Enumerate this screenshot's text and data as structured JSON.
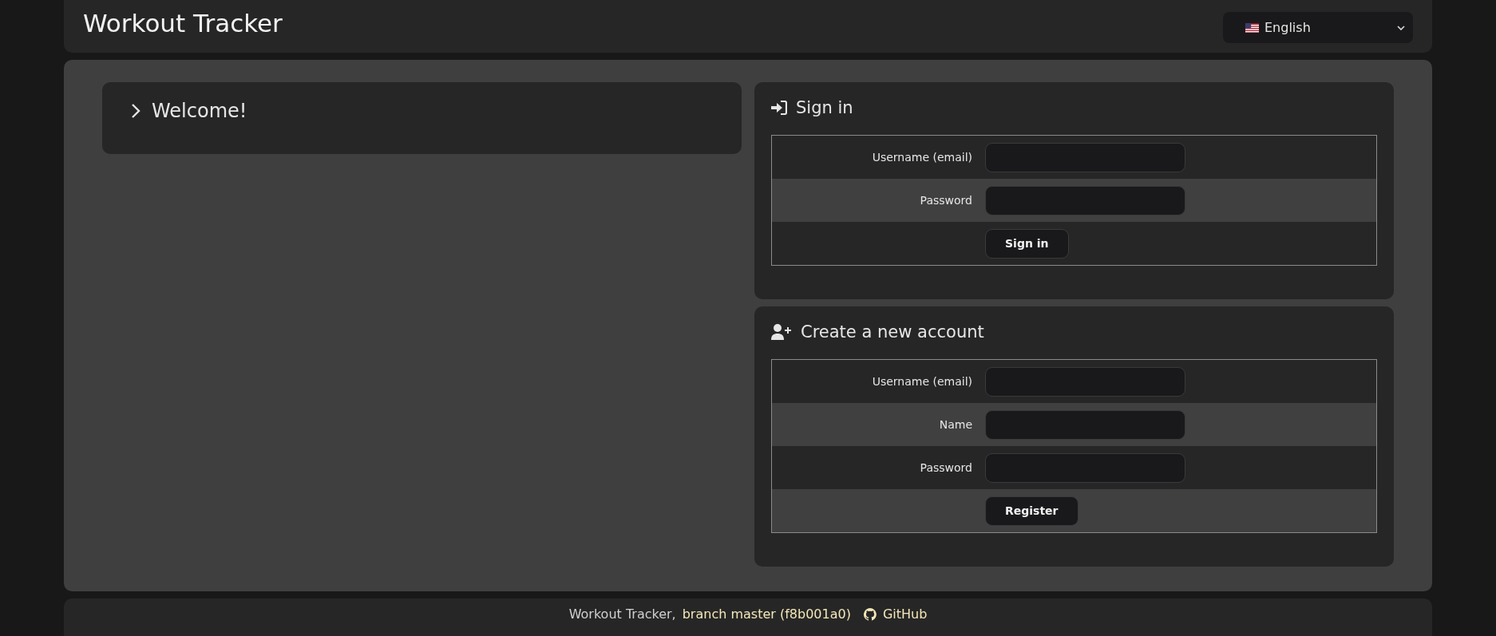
{
  "header": {
    "title": "Workout Tracker",
    "language": {
      "value": "English"
    }
  },
  "welcome": {
    "title": "Welcome!",
    "expanded": false
  },
  "forms": [
    {
      "kind": "sign-in",
      "title": "Sign in",
      "fields": [
        {
          "label": "Username (email)"
        },
        {
          "label": "Password"
        }
      ],
      "button": "Sign in"
    },
    {
      "kind": "register",
      "title": "Create a new account",
      "fields": [
        {
          "label": "Username (email)"
        },
        {
          "label": "Name"
        },
        {
          "label": "Password"
        }
      ],
      "button": "Register"
    }
  ],
  "footer": {
    "text": "Workout Tracker,",
    "branch_link": "branch master (f8b001a0)",
    "github_link": "GitHub"
  }
}
